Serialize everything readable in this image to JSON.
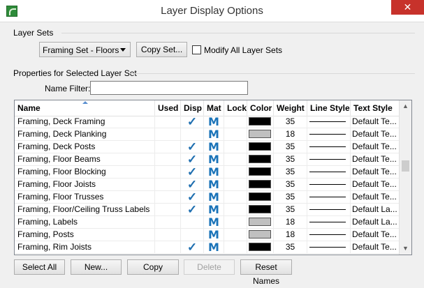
{
  "window": {
    "title": "Layer Display Options",
    "close_glyph": "✕"
  },
  "layer_sets": {
    "heading": "Layer Sets",
    "selected": "Framing Set - Floors",
    "copy_set_label": "Copy Set...",
    "modify_all_label": "Modify All Layer Sets",
    "modify_all_checked": false
  },
  "properties": {
    "heading": "Properties for Selected Layer Set",
    "name_filter_label": "Name Filter:",
    "name_filter_value": ""
  },
  "table": {
    "columns": [
      "Name",
      "Used",
      "Disp",
      "Mat",
      "Lock",
      "Color",
      "Weight",
      "Line Style",
      "Text Style"
    ],
    "sort_column": "Name",
    "rows": [
      {
        "name": "Framing, Deck Framing",
        "used": false,
        "disp": true,
        "mat": "M",
        "lock": false,
        "color": "#000000",
        "weight": "35",
        "text_style": "Default Te..."
      },
      {
        "name": "Framing, Deck Planking",
        "used": false,
        "disp": false,
        "mat": "M",
        "lock": false,
        "color": "#c0c0c0",
        "weight": "18",
        "text_style": "Default Te..."
      },
      {
        "name": "Framing, Deck Posts",
        "used": false,
        "disp": true,
        "mat": "M",
        "lock": false,
        "color": "#000000",
        "weight": "35",
        "text_style": "Default Te..."
      },
      {
        "name": "Framing, Floor Beams",
        "used": false,
        "disp": true,
        "mat": "M",
        "lock": false,
        "color": "#000000",
        "weight": "35",
        "text_style": "Default Te..."
      },
      {
        "name": "Framing, Floor Blocking",
        "used": false,
        "disp": true,
        "mat": "M",
        "lock": false,
        "color": "#000000",
        "weight": "35",
        "text_style": "Default Te..."
      },
      {
        "name": "Framing, Floor Joists",
        "used": false,
        "disp": true,
        "mat": "M",
        "lock": false,
        "color": "#000000",
        "weight": "35",
        "text_style": "Default Te..."
      },
      {
        "name": "Framing, Floor Trusses",
        "used": false,
        "disp": true,
        "mat": "M",
        "lock": false,
        "color": "#000000",
        "weight": "35",
        "text_style": "Default Te..."
      },
      {
        "name": "Framing, Floor/Ceiling Truss Labels",
        "used": false,
        "disp": true,
        "mat": "M",
        "lock": false,
        "color": "#000000",
        "weight": "35",
        "text_style": "Default La..."
      },
      {
        "name": "Framing, Labels",
        "used": false,
        "disp": false,
        "mat": "M",
        "lock": false,
        "color": "#c0c0c0",
        "weight": "18",
        "text_style": "Default La..."
      },
      {
        "name": "Framing, Posts",
        "used": false,
        "disp": false,
        "mat": "M",
        "lock": false,
        "color": "#c0c0c0",
        "weight": "18",
        "text_style": "Default Te..."
      },
      {
        "name": "Framing, Rim Joists",
        "used": false,
        "disp": true,
        "mat": "M",
        "lock": false,
        "color": "#000000",
        "weight": "35",
        "text_style": "Default Te..."
      }
    ]
  },
  "buttons": {
    "select_all": "Select All",
    "new": "New...",
    "copy": "Copy",
    "delete": "Delete",
    "reset_names": "Reset Names"
  },
  "icons": {
    "check": "checkmark-icon",
    "material": "material-icon"
  }
}
